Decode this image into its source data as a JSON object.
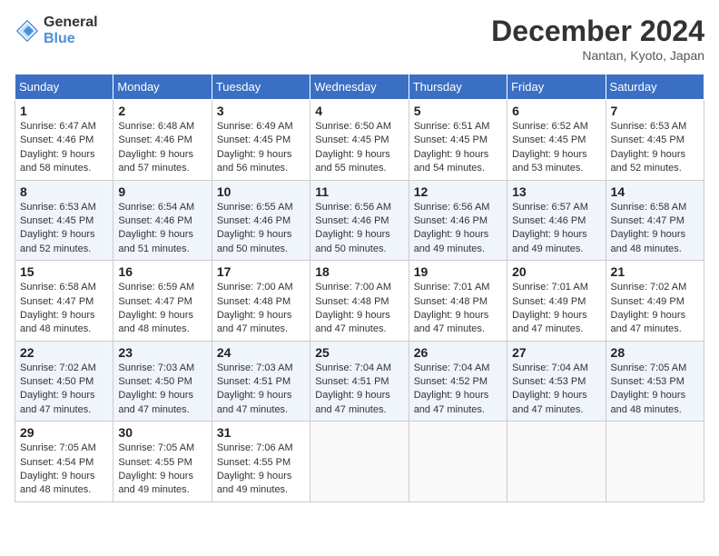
{
  "header": {
    "logo_line1": "General",
    "logo_line2": "Blue",
    "title": "December 2024",
    "subtitle": "Nantan, Kyoto, Japan"
  },
  "weekdays": [
    "Sunday",
    "Monday",
    "Tuesday",
    "Wednesday",
    "Thursday",
    "Friday",
    "Saturday"
  ],
  "weeks": [
    [
      {
        "day": 1,
        "sunrise": "6:47 AM",
        "sunset": "4:46 PM",
        "daylight": "9 hours and 58 minutes."
      },
      {
        "day": 2,
        "sunrise": "6:48 AM",
        "sunset": "4:46 PM",
        "daylight": "9 hours and 57 minutes."
      },
      {
        "day": 3,
        "sunrise": "6:49 AM",
        "sunset": "4:45 PM",
        "daylight": "9 hours and 56 minutes."
      },
      {
        "day": 4,
        "sunrise": "6:50 AM",
        "sunset": "4:45 PM",
        "daylight": "9 hours and 55 minutes."
      },
      {
        "day": 5,
        "sunrise": "6:51 AM",
        "sunset": "4:45 PM",
        "daylight": "9 hours and 54 minutes."
      },
      {
        "day": 6,
        "sunrise": "6:52 AM",
        "sunset": "4:45 PM",
        "daylight": "9 hours and 53 minutes."
      },
      {
        "day": 7,
        "sunrise": "6:53 AM",
        "sunset": "4:45 PM",
        "daylight": "9 hours and 52 minutes."
      }
    ],
    [
      {
        "day": 8,
        "sunrise": "6:53 AM",
        "sunset": "4:45 PM",
        "daylight": "9 hours and 52 minutes."
      },
      {
        "day": 9,
        "sunrise": "6:54 AM",
        "sunset": "4:46 PM",
        "daylight": "9 hours and 51 minutes."
      },
      {
        "day": 10,
        "sunrise": "6:55 AM",
        "sunset": "4:46 PM",
        "daylight": "9 hours and 50 minutes."
      },
      {
        "day": 11,
        "sunrise": "6:56 AM",
        "sunset": "4:46 PM",
        "daylight": "9 hours and 50 minutes."
      },
      {
        "day": 12,
        "sunrise": "6:56 AM",
        "sunset": "4:46 PM",
        "daylight": "9 hours and 49 minutes."
      },
      {
        "day": 13,
        "sunrise": "6:57 AM",
        "sunset": "4:46 PM",
        "daylight": "9 hours and 49 minutes."
      },
      {
        "day": 14,
        "sunrise": "6:58 AM",
        "sunset": "4:47 PM",
        "daylight": "9 hours and 48 minutes."
      }
    ],
    [
      {
        "day": 15,
        "sunrise": "6:58 AM",
        "sunset": "4:47 PM",
        "daylight": "9 hours and 48 minutes."
      },
      {
        "day": 16,
        "sunrise": "6:59 AM",
        "sunset": "4:47 PM",
        "daylight": "9 hours and 48 minutes."
      },
      {
        "day": 17,
        "sunrise": "7:00 AM",
        "sunset": "4:48 PM",
        "daylight": "9 hours and 47 minutes."
      },
      {
        "day": 18,
        "sunrise": "7:00 AM",
        "sunset": "4:48 PM",
        "daylight": "9 hours and 47 minutes."
      },
      {
        "day": 19,
        "sunrise": "7:01 AM",
        "sunset": "4:48 PM",
        "daylight": "9 hours and 47 minutes."
      },
      {
        "day": 20,
        "sunrise": "7:01 AM",
        "sunset": "4:49 PM",
        "daylight": "9 hours and 47 minutes."
      },
      {
        "day": 21,
        "sunrise": "7:02 AM",
        "sunset": "4:49 PM",
        "daylight": "9 hours and 47 minutes."
      }
    ],
    [
      {
        "day": 22,
        "sunrise": "7:02 AM",
        "sunset": "4:50 PM",
        "daylight": "9 hours and 47 minutes."
      },
      {
        "day": 23,
        "sunrise": "7:03 AM",
        "sunset": "4:50 PM",
        "daylight": "9 hours and 47 minutes."
      },
      {
        "day": 24,
        "sunrise": "7:03 AM",
        "sunset": "4:51 PM",
        "daylight": "9 hours and 47 minutes."
      },
      {
        "day": 25,
        "sunrise": "7:04 AM",
        "sunset": "4:51 PM",
        "daylight": "9 hours and 47 minutes."
      },
      {
        "day": 26,
        "sunrise": "7:04 AM",
        "sunset": "4:52 PM",
        "daylight": "9 hours and 47 minutes."
      },
      {
        "day": 27,
        "sunrise": "7:04 AM",
        "sunset": "4:53 PM",
        "daylight": "9 hours and 47 minutes."
      },
      {
        "day": 28,
        "sunrise": "7:05 AM",
        "sunset": "4:53 PM",
        "daylight": "9 hours and 48 minutes."
      }
    ],
    [
      {
        "day": 29,
        "sunrise": "7:05 AM",
        "sunset": "4:54 PM",
        "daylight": "9 hours and 48 minutes."
      },
      {
        "day": 30,
        "sunrise": "7:05 AM",
        "sunset": "4:55 PM",
        "daylight": "9 hours and 49 minutes."
      },
      {
        "day": 31,
        "sunrise": "7:06 AM",
        "sunset": "4:55 PM",
        "daylight": "9 hours and 49 minutes."
      },
      null,
      null,
      null,
      null
    ]
  ],
  "labels": {
    "sunrise": "Sunrise:",
    "sunset": "Sunset:",
    "daylight": "Daylight:"
  }
}
